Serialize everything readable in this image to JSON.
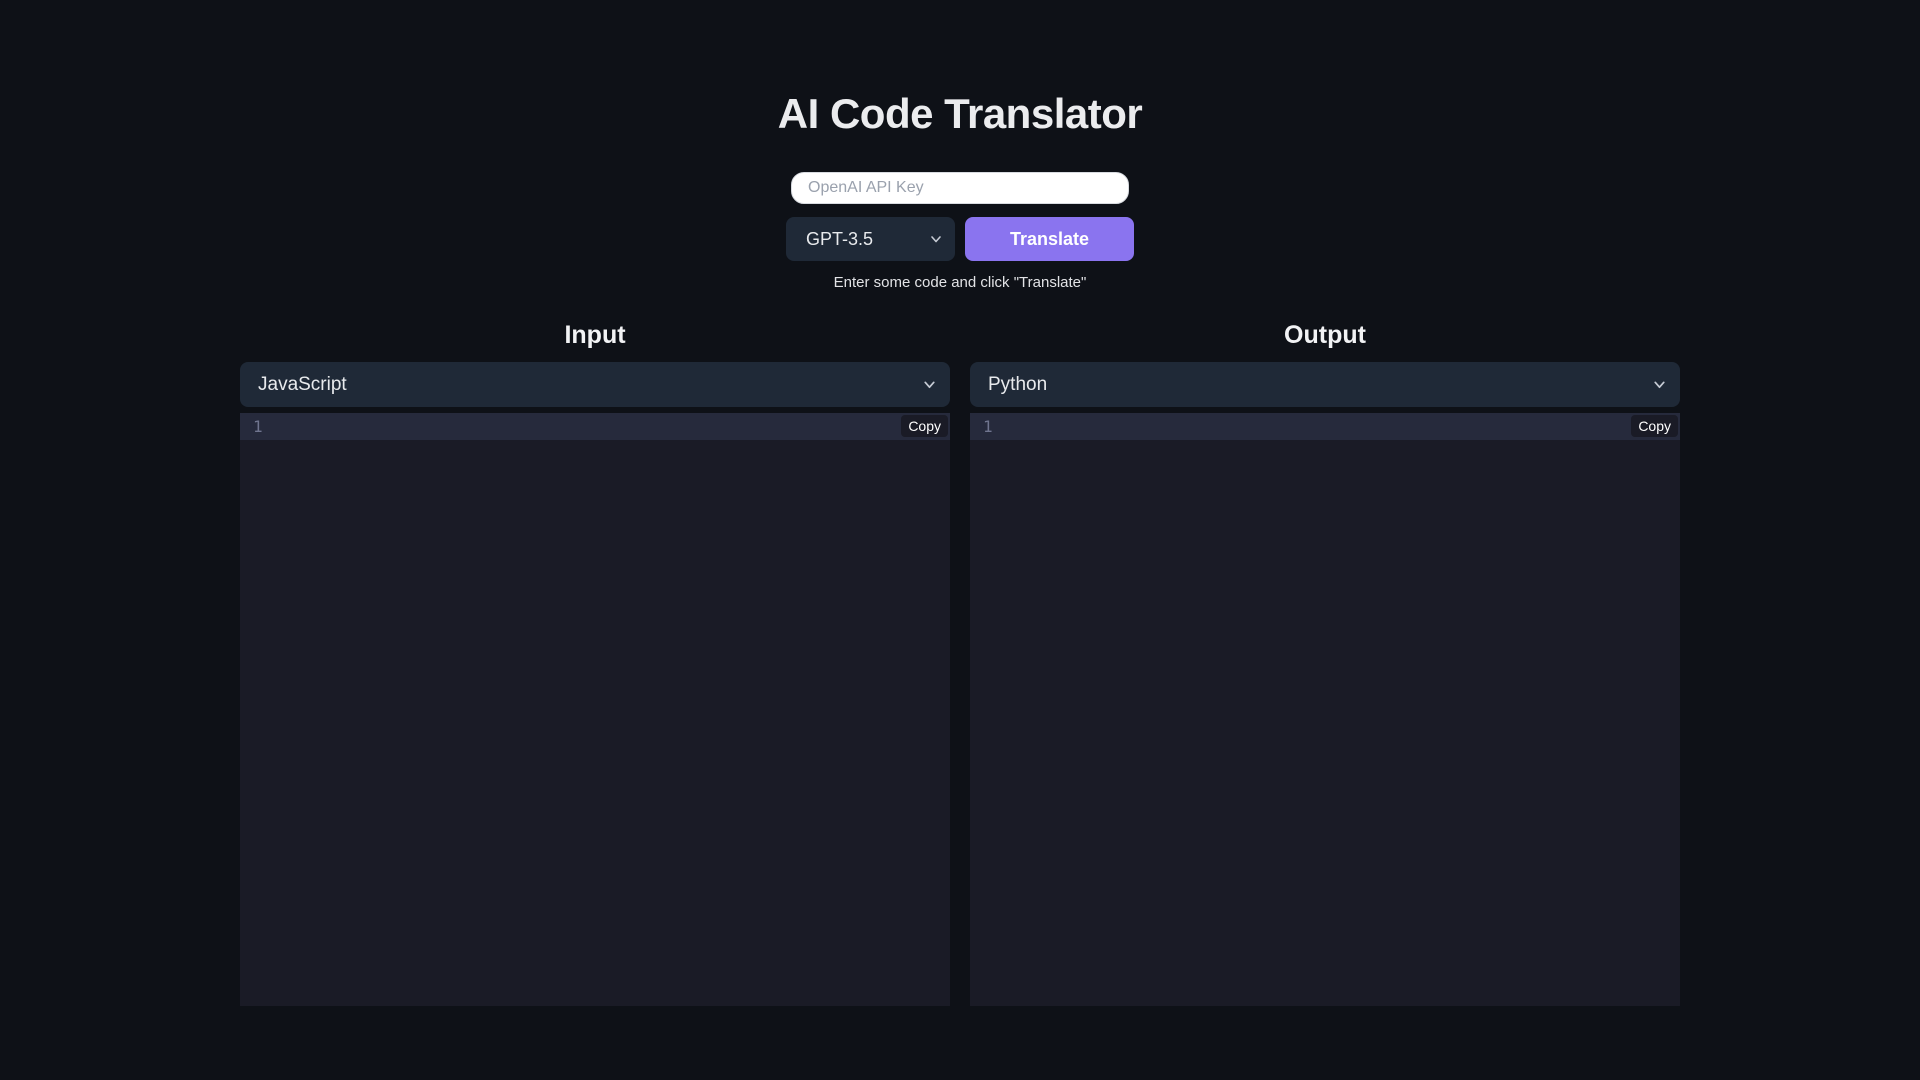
{
  "header": {
    "title": "AI Code Translator"
  },
  "api_key": {
    "placeholder": "OpenAI API Key",
    "value": ""
  },
  "controls": {
    "model": "GPT-3.5",
    "translate_label": "Translate"
  },
  "status_text": "Enter some code and click \"Translate\"",
  "panels": {
    "input": {
      "heading": "Input",
      "language": "JavaScript",
      "line_number": "1",
      "copy_label": "Copy",
      "code": ""
    },
    "output": {
      "heading": "Output",
      "language": "Python",
      "line_number": "1",
      "copy_label": "Copy",
      "code": ""
    }
  },
  "icons": {
    "model_chevron": "chevron-down",
    "input_language_chevron": "chevron-down",
    "output_language_chevron": "chevron-down"
  },
  "colors": {
    "page_bg": "#0e1117",
    "editor_bg": "#1a1b26",
    "editor_active_line": "#262a3c",
    "select_bg": "#1f2937",
    "accent_purple": "#8a74ef",
    "line_number": "#70758f"
  }
}
